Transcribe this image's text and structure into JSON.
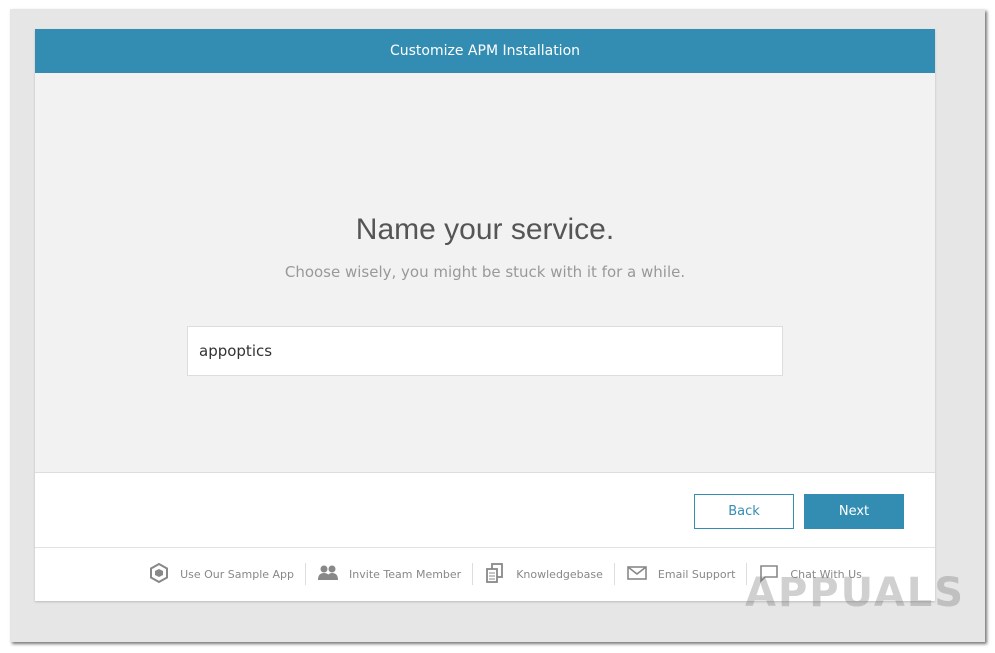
{
  "header": {
    "title": "Customize APM Installation"
  },
  "main": {
    "title": "Name your service.",
    "subtitle": "Choose wisely, you might be stuck with it for a while.",
    "service_name_value": "appoptics"
  },
  "actions": {
    "back": "Back",
    "next": "Next"
  },
  "footer": {
    "items": [
      {
        "icon": "cube-icon",
        "label": "Use Our Sample App"
      },
      {
        "icon": "users-icon",
        "label": "Invite Team Member"
      },
      {
        "icon": "documents-icon",
        "label": "Knowledgebase"
      },
      {
        "icon": "envelope-icon",
        "label": "Email Support"
      },
      {
        "icon": "chat-icon",
        "label": "Chat With Us"
      }
    ]
  },
  "watermark": "APPUALS",
  "colors": {
    "accent": "#338db2"
  }
}
